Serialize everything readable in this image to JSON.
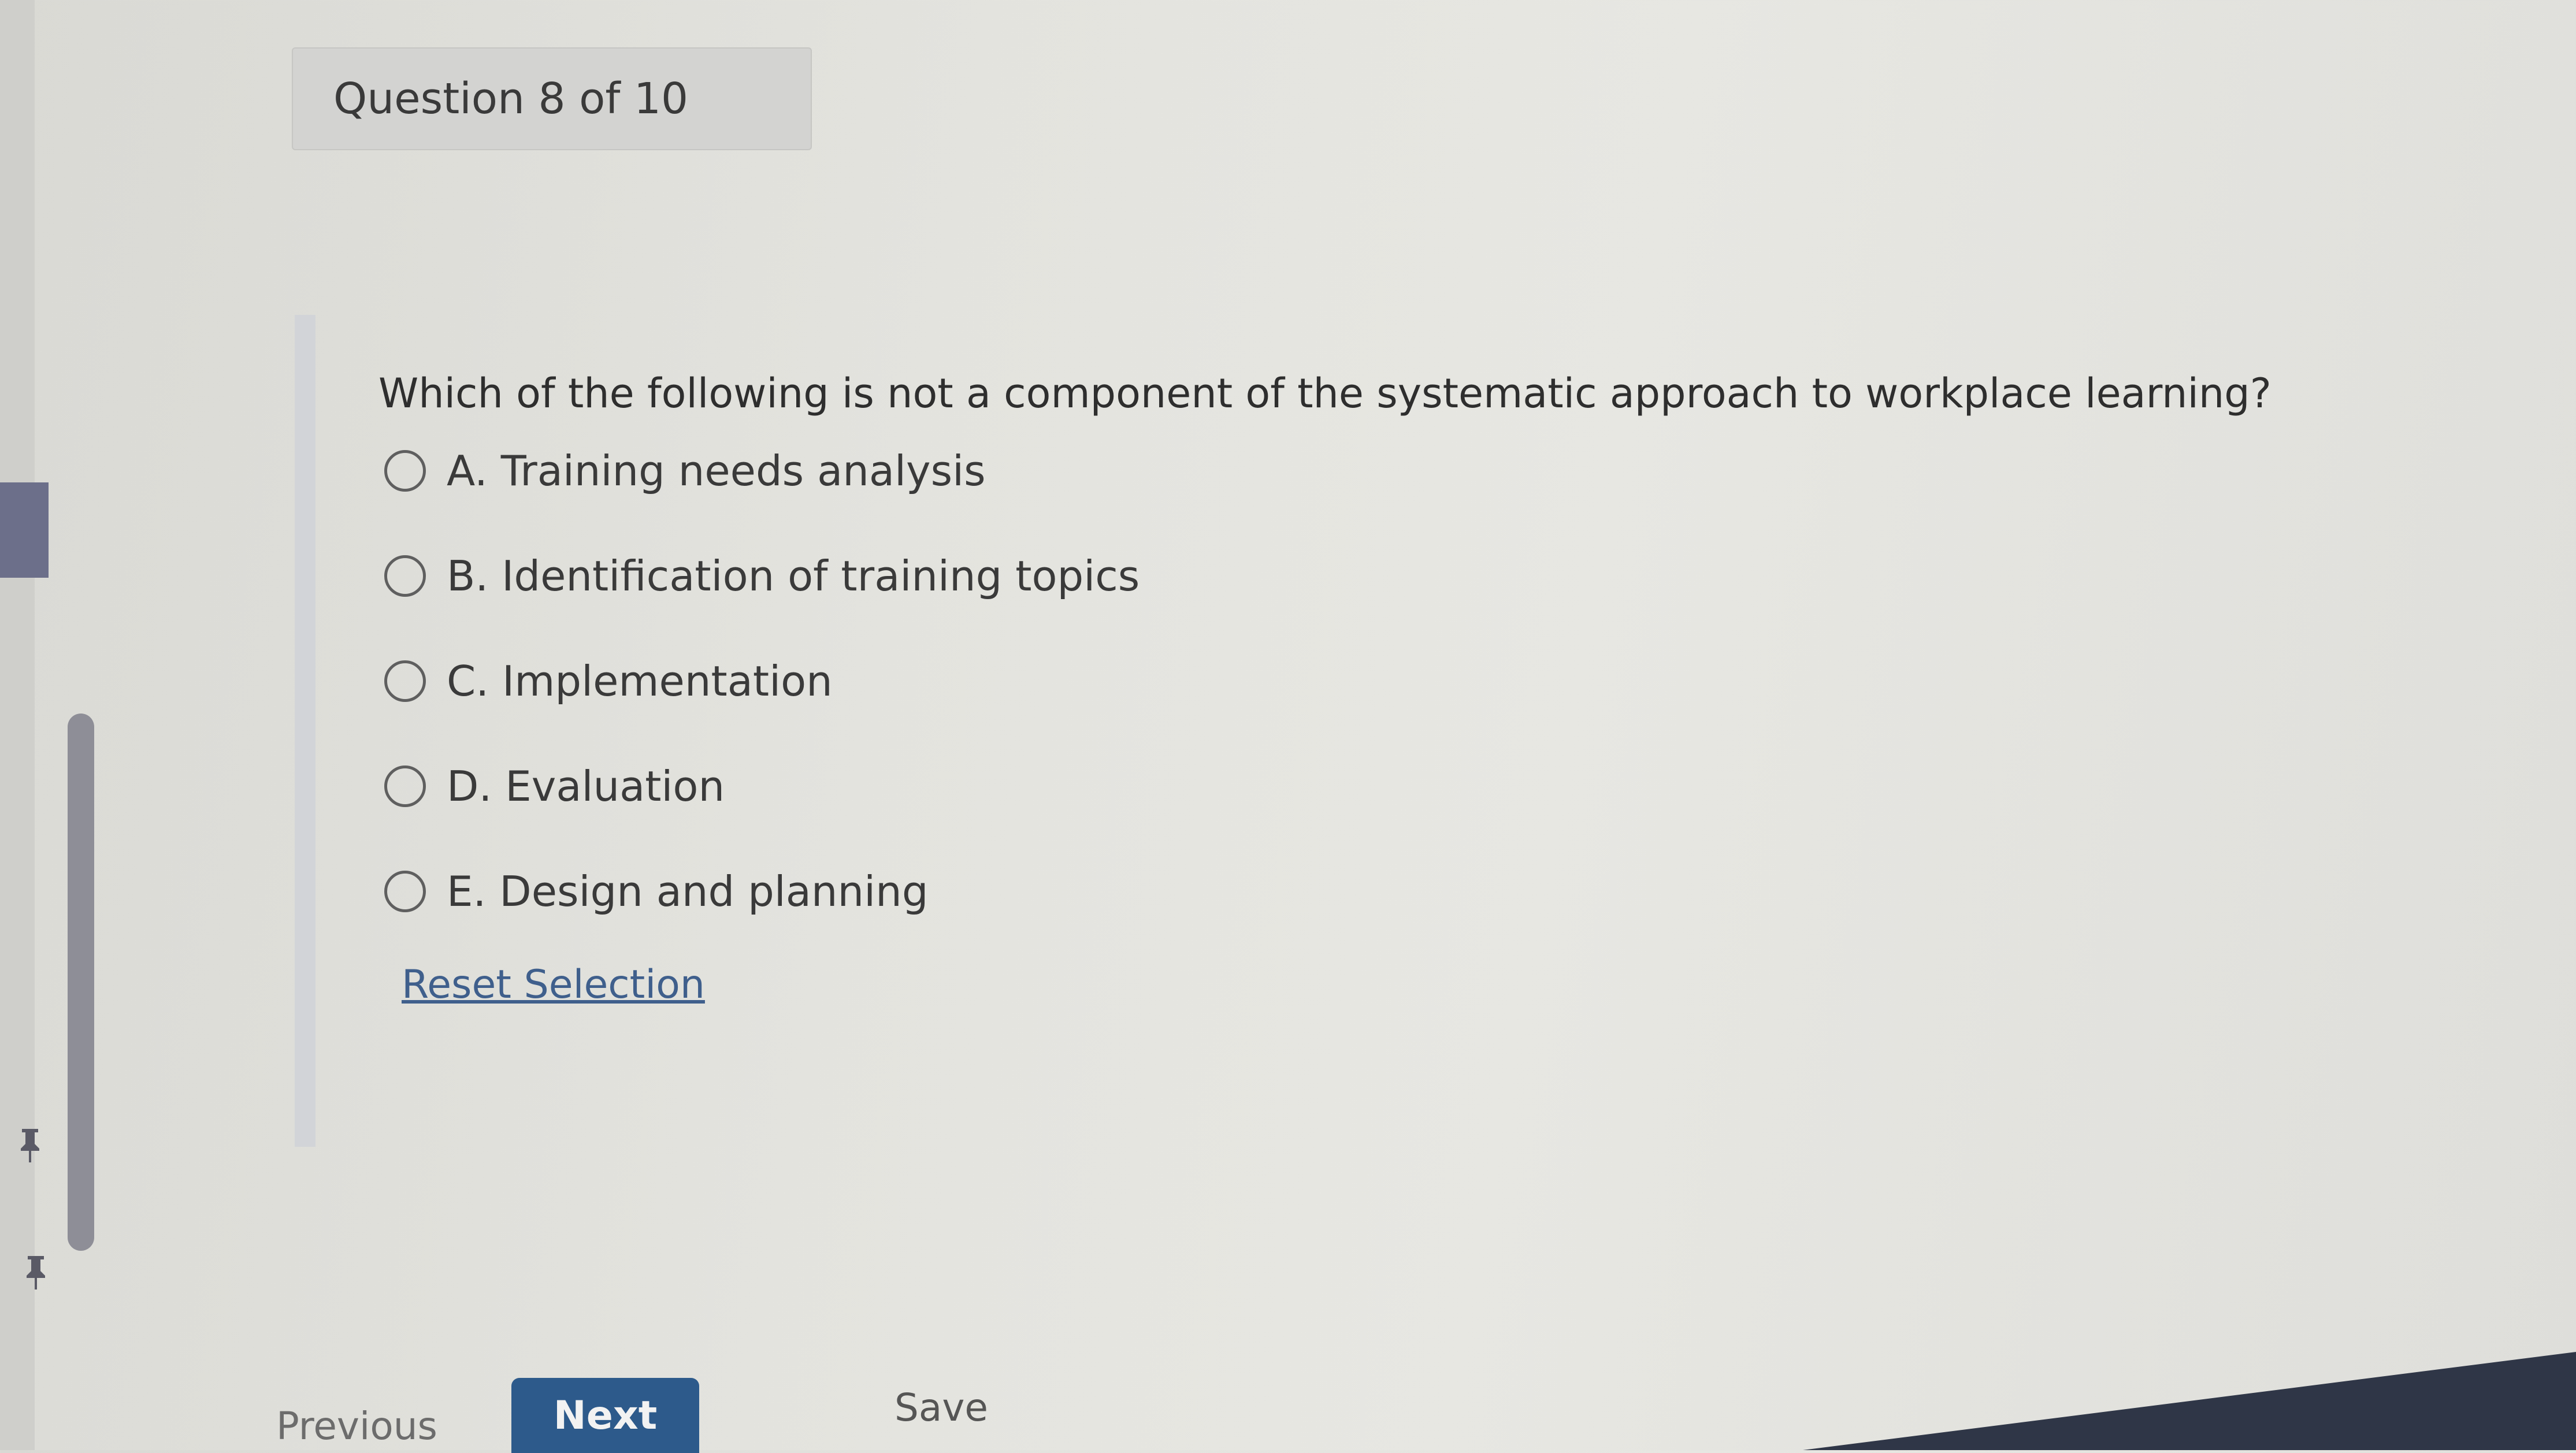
{
  "header": {
    "question_counter": "Question 8 of 10"
  },
  "question": {
    "text": "Which of the following is not a component of the systematic approach to workplace learning?",
    "options": [
      {
        "label": "A. Training needs analysis"
      },
      {
        "label": "B. Identification of training topics"
      },
      {
        "label": "C. Implementation"
      },
      {
        "label": "D. Evaluation"
      },
      {
        "label": "E. Design and planning"
      }
    ],
    "reset_label": "Reset Selection"
  },
  "navigation": {
    "previous_label": "Previous",
    "next_label": "Next",
    "save_label": "Save"
  },
  "colors": {
    "accent": "#2d5a8b",
    "link": "#3f5f8c"
  }
}
